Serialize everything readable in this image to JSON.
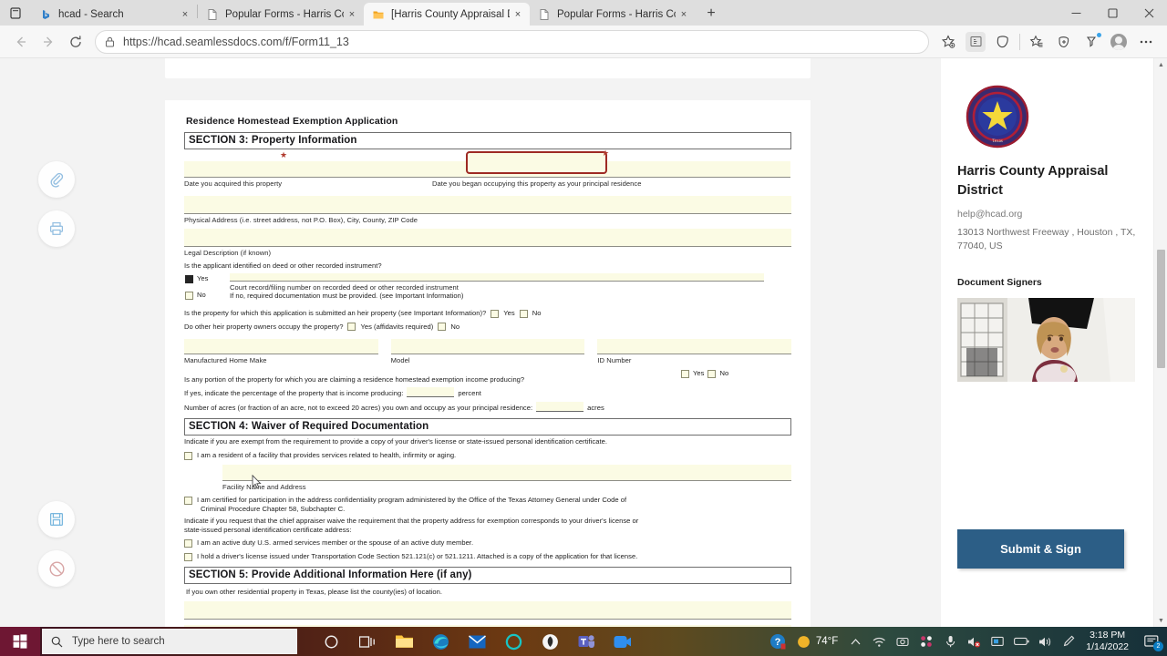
{
  "browser": {
    "tabs": [
      {
        "title": "hcad - Search",
        "favicon": "bing-icon",
        "active": false
      },
      {
        "title": "Popular Forms - Harris County A",
        "favicon": "page-icon",
        "active": false
      },
      {
        "title": "[Harris County Appraisal District",
        "favicon": "folder-icon",
        "active": true
      },
      {
        "title": "Popular Forms - Harris County A",
        "favicon": "page-icon",
        "active": false
      }
    ],
    "new_tab_label": "+",
    "close_label": "×",
    "window_controls": {
      "minimize": "—",
      "maximize": "❐",
      "close": "✕"
    },
    "address": {
      "scheme": "https://",
      "host": "hcad.seamlessdocs.com",
      "path": "/f/Form11_13",
      "full": "https://hcad.seamlessdocs.com/f/Form11_13"
    },
    "toolbar_icons": [
      "favorite-add-icon",
      "immersive-reader-icon",
      "collections-icon",
      "favorites-icon",
      "browser-essentials-icon",
      "extensions-icon",
      "profile-icon",
      "settings-more-icon"
    ],
    "nav_icons": [
      "back-icon",
      "forward-icon",
      "refresh-icon"
    ]
  },
  "left_rail": {
    "buttons": [
      {
        "name": "attachment-icon",
        "label": "Attach"
      },
      {
        "name": "print-icon",
        "label": "Print"
      },
      {
        "name": "save-icon",
        "label": "Save"
      },
      {
        "name": "cancel-icon",
        "label": "Decline"
      }
    ]
  },
  "form": {
    "title": "Residence Homestead Exemption Application",
    "section3": {
      "heading": "SECTION 3: Property Information",
      "date_acquired_label": "Date you acquired this property",
      "date_occupied_label": "Date you began occupying this property as your principal residence",
      "date_acquired_value": "",
      "date_occupied_value": "",
      "physical_address_label": "Physical Address (i.e. street address, not P.O. Box), City, County, ZIP Code",
      "physical_address_value": "",
      "legal_description_label": "Legal Description (if known)",
      "legal_description_value": "",
      "deed_question": "Is the applicant identified on deed or other recorded instrument?",
      "yes_label": "Yes",
      "no_label": "No",
      "yes_checked": true,
      "no_checked": false,
      "court_record_label": "Court record/filing number on recorded deed or other recorded instrument",
      "court_record_value": "",
      "no_hint": "If no, required documentation must be provided. (see Important Information)",
      "heir_question": "Is the property for which this application is submitted an heir property (see Important Information)?",
      "heir_yes": "Yes",
      "heir_no": "No",
      "heir_occupy_question": "Do other heir property owners occupy the property?",
      "heir_occupy_yes": "Yes (affidavits required)",
      "heir_occupy_no": "No",
      "mh_make_label": "Manufactured Home Make",
      "mh_model_label": "Model",
      "mh_id_label": "ID Number",
      "mh_make_value": "",
      "mh_model_value": "",
      "mh_id_value": "",
      "income_question": "Is any portion of the property for which you are claiming a residence homestead exemption income producing?",
      "income_yes": "Yes",
      "income_no": "No",
      "percent_question_pre": "If yes, indicate the percentage of the property that is income producing:",
      "percent_unit": "percent",
      "percent_value": "",
      "acres_question_pre": "Number of acres (or fraction of an acre, not to exceed 20 acres) you own and occupy as your principal residence:",
      "acres_unit": "acres",
      "acres_value": ""
    },
    "section4": {
      "heading": "SECTION 4: Waiver of Required Documentation",
      "intro": "Indicate if you are exempt from the requirement to provide a copy of your driver's license or state-issued personal identification certificate.",
      "option1": "I am a resident of a facility that provides services related to health, infirmity or aging.",
      "facility_label": "Facility Name and Address",
      "facility_value": "",
      "option2_line1": "I am certified for participation in the address confidentiality program administered by the Office of the Texas Attorney General under Code of",
      "option2_line2": "Criminal Procedure Chapter 58, Subchapter C.",
      "intro2_line1": "Indicate if you request that the chief appraiser waive the requirement that the property address for exemption corresponds to your driver's license or",
      "intro2_line2": "state-issued personal identification certificate address:",
      "option3": "I am an active duty U.S. armed services member or the spouse of an active duty member.",
      "option4": "I hold a driver's license issued under Transportation Code Section 521.121(c) or 521.1211. Attached is a copy of the application for that license."
    },
    "section5": {
      "heading": "SECTION 5: Provide Additional Information Here (if any)",
      "prompt": "If you own other residential property in Texas, please list the county(ies) of location.",
      "line1_value": "",
      "line2_value": ""
    }
  },
  "sidebar": {
    "org_name": "Harris County Appraisal District",
    "email": "help@hcad.org",
    "address": "13013 Northwest Freeway , Houston , TX, 77040, US",
    "signers_label": "Document Signers",
    "submit_label": "Submit & Sign",
    "seal_text_top": "HARRIS COUNTY APPRAISAL DISTRICT",
    "seal_text_bottom": "Texas"
  },
  "taskbar": {
    "search_placeholder": "Type here to search",
    "temperature": "74°F",
    "time": "3:18 PM",
    "date": "1/14/2022",
    "notification_count": "2",
    "icons": [
      "cortana-icon",
      "task-view-icon",
      "file-explorer-icon",
      "edge-icon",
      "mail-icon",
      "cortana-circle-icon",
      "app-icon",
      "teams-icon",
      "zoom-icon"
    ],
    "tray_icons": [
      "help-icon",
      "weather-icon",
      "show-hidden-icon",
      "network-icon",
      "camera-icon",
      "teams-tray-icon",
      "mic-icon",
      "audio-mute-icon",
      "display-icon",
      "battery-icon",
      "volume-icon",
      "pen-icon"
    ]
  },
  "colors": {
    "accent_button": "#2c5e86",
    "highlight_border": "#9e2a24",
    "field_fill": "#fbfbe4",
    "start_button": "#6e1733"
  }
}
